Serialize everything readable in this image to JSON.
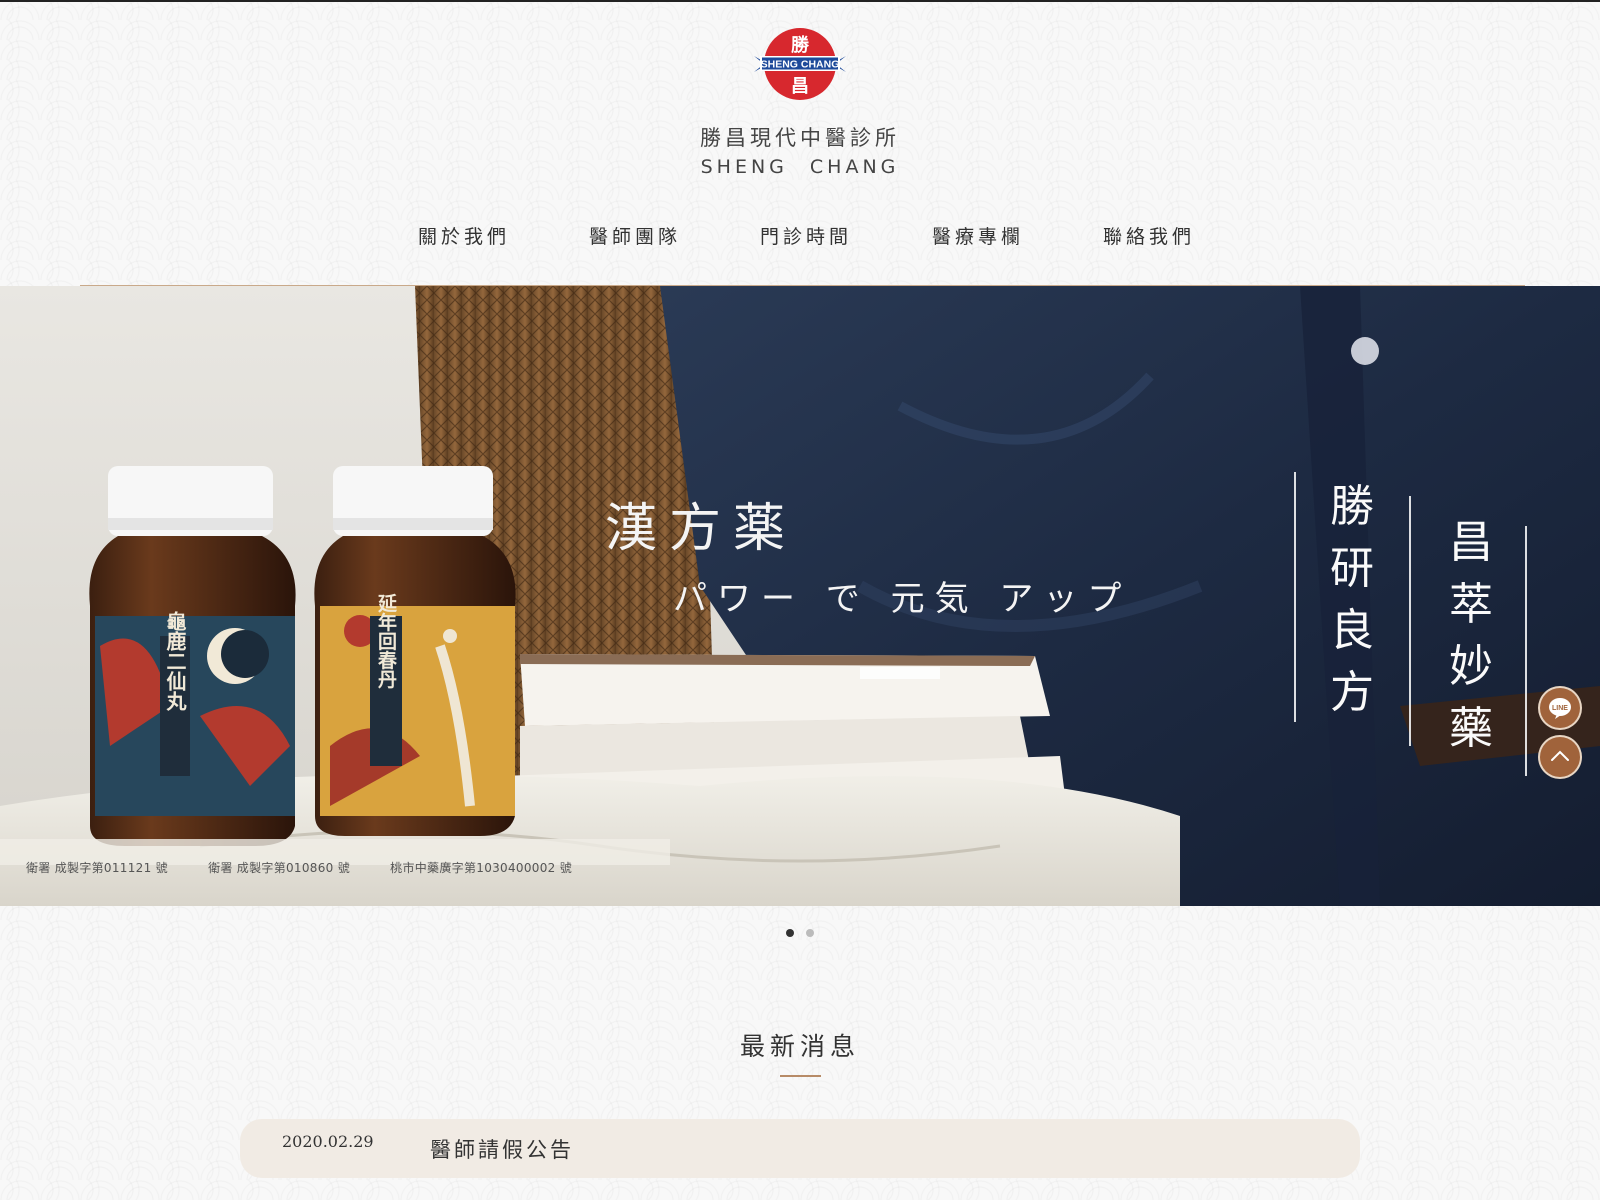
{
  "brand": {
    "logo_cn": "勝",
    "logo_cn2": "昌",
    "logo_en": "SHENG CHANG",
    "name_cn": "勝昌現代中醫診所",
    "name_en_1": "SHENG",
    "name_en_2": "CHANG"
  },
  "nav": {
    "items": [
      {
        "label": "關於我們"
      },
      {
        "label": "醫師團隊"
      },
      {
        "label": "門診時間"
      },
      {
        "label": "醫療專欄"
      },
      {
        "label": "聯絡我們"
      }
    ]
  },
  "hero": {
    "title": "漢方薬",
    "subtitle": "パワー で 元気 アップ",
    "vertical_1": "勝研良方",
    "vertical_2": "昌萃妙藥",
    "jar_1_label": "龜鹿二仙丸",
    "jar_2_label": "延年回春丹",
    "license": [
      "衛署 成製字第011121 號",
      "衛署 成製字第010860 號",
      "桃市中藥廣字第1030400002 號"
    ],
    "slide_count": 2,
    "active_slide": 1
  },
  "floating": {
    "line_icon": "line-icon",
    "line_label": "LINE",
    "top_icon": "chevron-up-icon"
  },
  "news": {
    "title": "最新消息",
    "items": [
      {
        "date": "2020.02.29",
        "title": "醫師請假公告"
      }
    ]
  },
  "colors": {
    "brand_red": "#d7282e",
    "brand_blue": "#1e4a9a",
    "accent_brown": "#a0633b",
    "news_bg": "#f1ebe4"
  }
}
